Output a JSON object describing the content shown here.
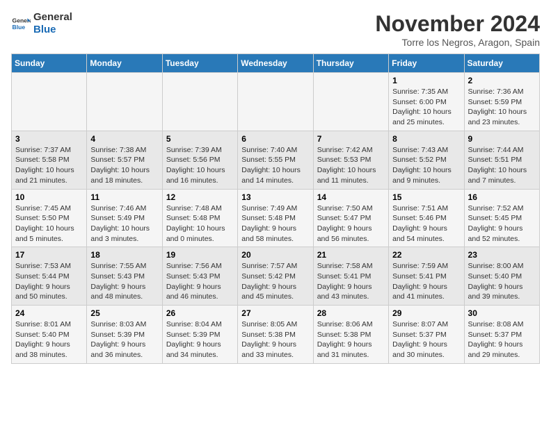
{
  "logo": {
    "line1": "General",
    "line2": "Blue"
  },
  "title": "November 2024",
  "location": "Torre los Negros, Aragon, Spain",
  "days_header": [
    "Sunday",
    "Monday",
    "Tuesday",
    "Wednesday",
    "Thursday",
    "Friday",
    "Saturday"
  ],
  "weeks": [
    [
      {
        "day": "",
        "info": ""
      },
      {
        "day": "",
        "info": ""
      },
      {
        "day": "",
        "info": ""
      },
      {
        "day": "",
        "info": ""
      },
      {
        "day": "",
        "info": ""
      },
      {
        "day": "1",
        "info": "Sunrise: 7:35 AM\nSunset: 6:00 PM\nDaylight: 10 hours and 25 minutes."
      },
      {
        "day": "2",
        "info": "Sunrise: 7:36 AM\nSunset: 5:59 PM\nDaylight: 10 hours and 23 minutes."
      }
    ],
    [
      {
        "day": "3",
        "info": "Sunrise: 7:37 AM\nSunset: 5:58 PM\nDaylight: 10 hours and 21 minutes."
      },
      {
        "day": "4",
        "info": "Sunrise: 7:38 AM\nSunset: 5:57 PM\nDaylight: 10 hours and 18 minutes."
      },
      {
        "day": "5",
        "info": "Sunrise: 7:39 AM\nSunset: 5:56 PM\nDaylight: 10 hours and 16 minutes."
      },
      {
        "day": "6",
        "info": "Sunrise: 7:40 AM\nSunset: 5:55 PM\nDaylight: 10 hours and 14 minutes."
      },
      {
        "day": "7",
        "info": "Sunrise: 7:42 AM\nSunset: 5:53 PM\nDaylight: 10 hours and 11 minutes."
      },
      {
        "day": "8",
        "info": "Sunrise: 7:43 AM\nSunset: 5:52 PM\nDaylight: 10 hours and 9 minutes."
      },
      {
        "day": "9",
        "info": "Sunrise: 7:44 AM\nSunset: 5:51 PM\nDaylight: 10 hours and 7 minutes."
      }
    ],
    [
      {
        "day": "10",
        "info": "Sunrise: 7:45 AM\nSunset: 5:50 PM\nDaylight: 10 hours and 5 minutes."
      },
      {
        "day": "11",
        "info": "Sunrise: 7:46 AM\nSunset: 5:49 PM\nDaylight: 10 hours and 3 minutes."
      },
      {
        "day": "12",
        "info": "Sunrise: 7:48 AM\nSunset: 5:48 PM\nDaylight: 10 hours and 0 minutes."
      },
      {
        "day": "13",
        "info": "Sunrise: 7:49 AM\nSunset: 5:48 PM\nDaylight: 9 hours and 58 minutes."
      },
      {
        "day": "14",
        "info": "Sunrise: 7:50 AM\nSunset: 5:47 PM\nDaylight: 9 hours and 56 minutes."
      },
      {
        "day": "15",
        "info": "Sunrise: 7:51 AM\nSunset: 5:46 PM\nDaylight: 9 hours and 54 minutes."
      },
      {
        "day": "16",
        "info": "Sunrise: 7:52 AM\nSunset: 5:45 PM\nDaylight: 9 hours and 52 minutes."
      }
    ],
    [
      {
        "day": "17",
        "info": "Sunrise: 7:53 AM\nSunset: 5:44 PM\nDaylight: 9 hours and 50 minutes."
      },
      {
        "day": "18",
        "info": "Sunrise: 7:55 AM\nSunset: 5:43 PM\nDaylight: 9 hours and 48 minutes."
      },
      {
        "day": "19",
        "info": "Sunrise: 7:56 AM\nSunset: 5:43 PM\nDaylight: 9 hours and 46 minutes."
      },
      {
        "day": "20",
        "info": "Sunrise: 7:57 AM\nSunset: 5:42 PM\nDaylight: 9 hours and 45 minutes."
      },
      {
        "day": "21",
        "info": "Sunrise: 7:58 AM\nSunset: 5:41 PM\nDaylight: 9 hours and 43 minutes."
      },
      {
        "day": "22",
        "info": "Sunrise: 7:59 AM\nSunset: 5:41 PM\nDaylight: 9 hours and 41 minutes."
      },
      {
        "day": "23",
        "info": "Sunrise: 8:00 AM\nSunset: 5:40 PM\nDaylight: 9 hours and 39 minutes."
      }
    ],
    [
      {
        "day": "24",
        "info": "Sunrise: 8:01 AM\nSunset: 5:40 PM\nDaylight: 9 hours and 38 minutes."
      },
      {
        "day": "25",
        "info": "Sunrise: 8:03 AM\nSunset: 5:39 PM\nDaylight: 9 hours and 36 minutes."
      },
      {
        "day": "26",
        "info": "Sunrise: 8:04 AM\nSunset: 5:39 PM\nDaylight: 9 hours and 34 minutes."
      },
      {
        "day": "27",
        "info": "Sunrise: 8:05 AM\nSunset: 5:38 PM\nDaylight: 9 hours and 33 minutes."
      },
      {
        "day": "28",
        "info": "Sunrise: 8:06 AM\nSunset: 5:38 PM\nDaylight: 9 hours and 31 minutes."
      },
      {
        "day": "29",
        "info": "Sunrise: 8:07 AM\nSunset: 5:37 PM\nDaylight: 9 hours and 30 minutes."
      },
      {
        "day": "30",
        "info": "Sunrise: 8:08 AM\nSunset: 5:37 PM\nDaylight: 9 hours and 29 minutes."
      }
    ]
  ]
}
